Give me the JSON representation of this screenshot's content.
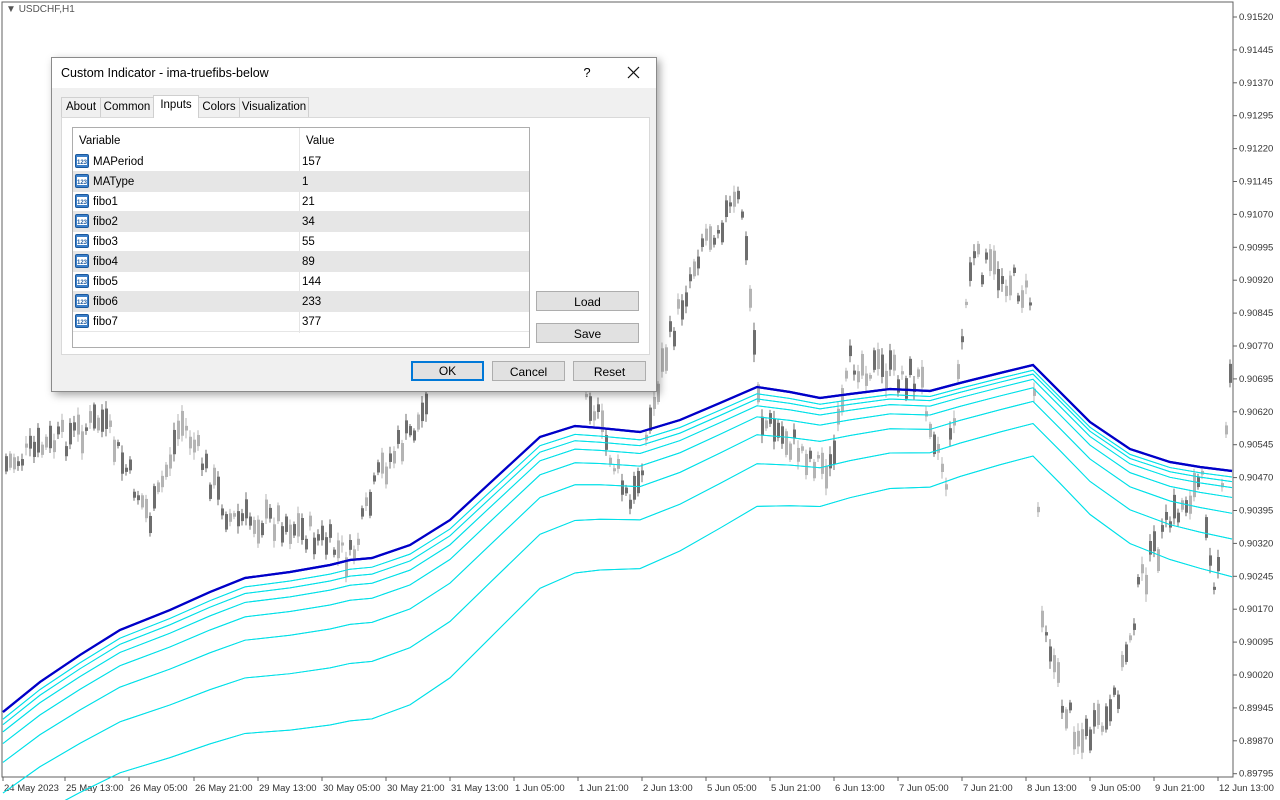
{
  "chart": {
    "symbol_title": "USDCHF,H1",
    "price_axis": [
      "0.91520",
      "0.91445",
      "0.91370",
      "0.91295",
      "0.91220",
      "0.91145",
      "0.91070",
      "0.90995",
      "0.90920",
      "0.90845",
      "0.90770",
      "0.90695",
      "0.90620",
      "0.90545",
      "0.90470",
      "0.90395",
      "0.90320",
      "0.90245",
      "0.90170",
      "0.90095",
      "0.90020",
      "0.89945",
      "0.89870",
      "0.89795"
    ],
    "time_axis": [
      "24 May 2023",
      "25 May 13:00",
      "26 May 05:00",
      "26 May 21:00",
      "29 May 13:00",
      "30 May 05:00",
      "30 May 21:00",
      "31 May 13:00",
      "1 Jun 05:00",
      "1 Jun 21:00",
      "2 Jun 13:00",
      "5 Jun 05:00",
      "5 Jun 21:00",
      "6 Jun 13:00",
      "7 Jun 05:00",
      "7 Jun 21:00",
      "8 Jun 13:00",
      "9 Jun 05:00",
      "9 Jun 21:00",
      "12 Jun 13:00"
    ],
    "colors": {
      "main_ma": "#0000c8",
      "fibo_bands": "#00e0e8",
      "candles": "#9a9a9a"
    }
  },
  "dialog": {
    "title": "Custom Indicator - ima-truefibs-below",
    "help_label": "?",
    "close_icon": "close-icon",
    "tabs": [
      "About",
      "Common",
      "Inputs",
      "Colors",
      "Visualization"
    ],
    "active_tab": "Inputs",
    "grid": {
      "headers": {
        "variable": "Variable",
        "value": "Value"
      },
      "rows": [
        {
          "variable": "MAPeriod",
          "value": "157"
        },
        {
          "variable": "MAType",
          "value": "1"
        },
        {
          "variable": "fibo1",
          "value": "21"
        },
        {
          "variable": "fibo2",
          "value": "34"
        },
        {
          "variable": "fibo3",
          "value": "55"
        },
        {
          "variable": "fibo4",
          "value": "89"
        },
        {
          "variable": "fibo5",
          "value": "144"
        },
        {
          "variable": "fibo6",
          "value": "233"
        },
        {
          "variable": "fibo7",
          "value": "377"
        }
      ],
      "row_icon": "integer-param-icon",
      "icon_text": "123"
    },
    "buttons": {
      "load": "Load",
      "save": "Save",
      "ok": "OK",
      "cancel": "Cancel",
      "reset": "Reset"
    }
  }
}
